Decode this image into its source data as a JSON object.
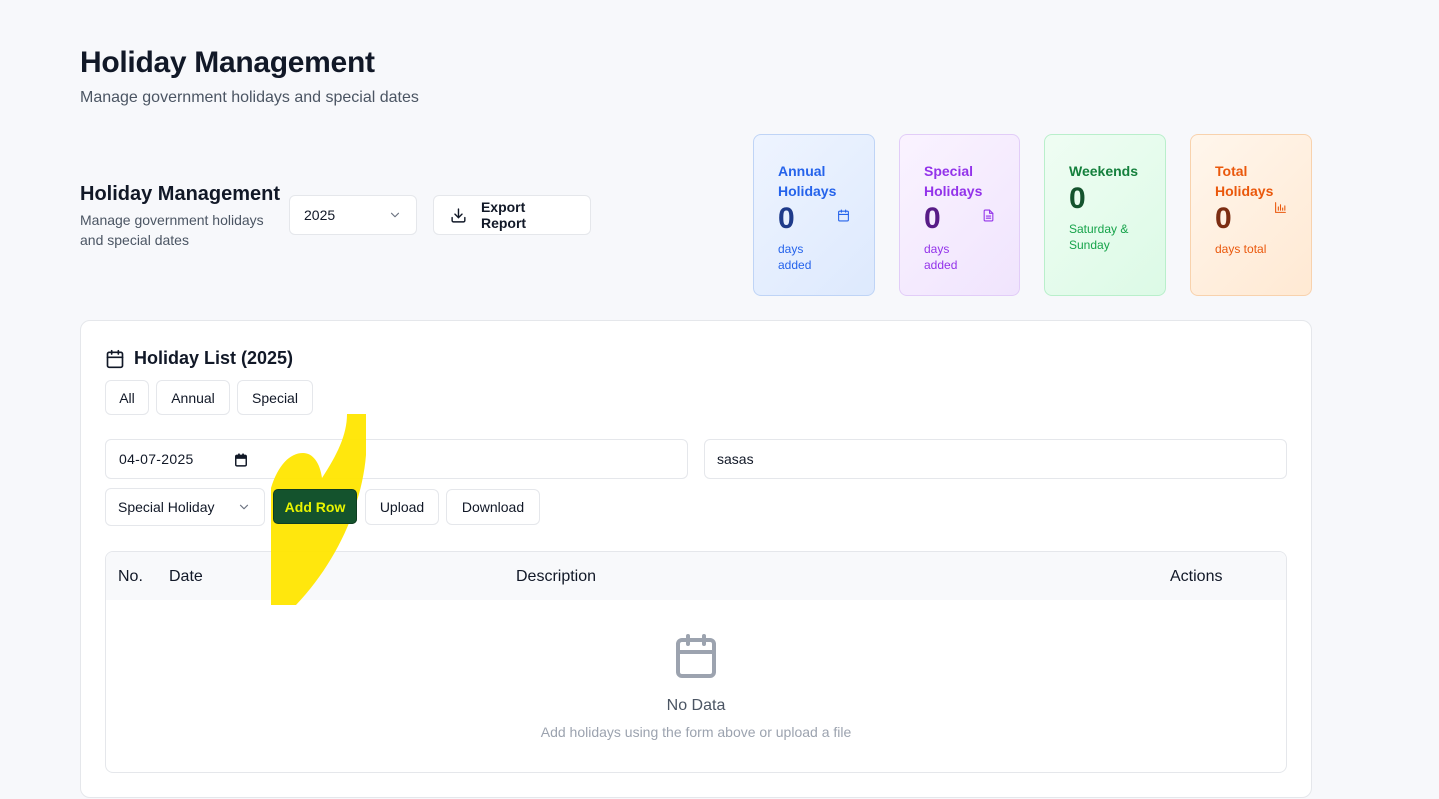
{
  "header": {
    "title": "Holiday Management",
    "subtitle": "Manage government holidays and special dates"
  },
  "section": {
    "title": "Holiday Management",
    "subtitle": "Manage government holidays and special dates"
  },
  "controls": {
    "year_value": "2025",
    "export_label": "Export Report"
  },
  "stats": {
    "annual": {
      "label": "Annual Holidays",
      "value": "0",
      "sub": "days added",
      "icon": "calendar-icon",
      "color": "#2563eb"
    },
    "special": {
      "label": "Special Holidays",
      "value": "0",
      "sub": "days added",
      "icon": "document-icon",
      "color": "#9333ea"
    },
    "weekends": {
      "label": "Weekends",
      "value": "0",
      "sub": "Saturday & Sunday",
      "color": "#15803d"
    },
    "total": {
      "label": "Total Holidays",
      "value": "0",
      "sub": "days total",
      "icon": "bar-chart-icon",
      "color": "#ea580c"
    }
  },
  "list": {
    "title": "Holiday List (2025)",
    "filters": [
      "All",
      "Annual",
      "Special"
    ]
  },
  "form": {
    "date_value": "04-07-2025",
    "description_value": "sasas",
    "type_value": "Special Holiday",
    "add_row_label": "Add Row",
    "upload_label": "Upload",
    "download_label": "Download"
  },
  "table": {
    "columns": [
      "No.",
      "Date",
      "Description",
      "Actions"
    ],
    "empty_title": "No Data",
    "empty_subtitle": "Add holidays using the form above or upload a file"
  },
  "colors": {
    "add_row_bg": "#14532d",
    "add_row_text": "#e9f500",
    "highlight": "#ffe600"
  }
}
